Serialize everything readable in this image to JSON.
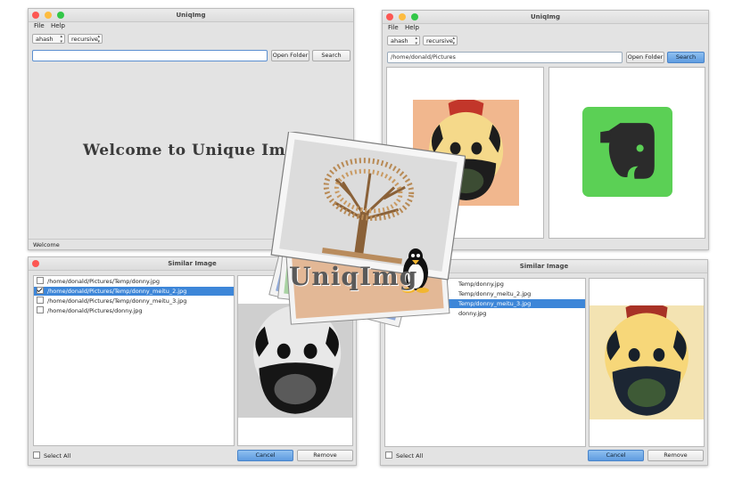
{
  "main_window": {
    "title": "UniqImg",
    "menu": [
      "File",
      "Help"
    ],
    "algorithm": "ahash",
    "mode": "recursive",
    "path_value": "",
    "open_folder": "Open Folder",
    "search": "Search",
    "welcome": "Welcome to Unique Image",
    "status": "Welcome"
  },
  "results_window": {
    "title": "UniqImg",
    "menu": [
      "File",
      "Help"
    ],
    "algorithm": "ahash",
    "mode": "recursive",
    "path_value": "/home/donald/Pictures",
    "open_folder": "Open Folder",
    "search": "Search"
  },
  "similar_left": {
    "title": "Similar Image",
    "items": [
      {
        "label": "/home/donald/Pictures/Temp/donny.jpg",
        "checked": false
      },
      {
        "label": "/home/donald/Pictures/Temp/donny_meitu_2.jpg",
        "checked": true
      },
      {
        "label": "/home/donald/Pictures/Temp/donny_meitu_3.jpg",
        "checked": false
      },
      {
        "label": "/home/donald/Pictures/donny.jpg",
        "checked": false
      }
    ],
    "select_all": "Select All",
    "cancel": "Cancel",
    "remove": "Remove"
  },
  "similar_right": {
    "title": "Similar Image",
    "items": [
      {
        "label": "Temp/donny.jpg"
      },
      {
        "label": "Temp/donny_meitu_2.jpg"
      },
      {
        "label": "Temp/donny_meitu_3.jpg"
      },
      {
        "label": "donny.jpg"
      }
    ],
    "select_all": "Select All",
    "cancel": "Cancel",
    "remove": "Remove"
  },
  "logo": {
    "text": "UniqImg",
    "icons": [
      "tree-icon",
      "penguin-icon"
    ]
  },
  "colors": {
    "selection": "#3d86d8",
    "button_blue": "#5e9be0",
    "evernote_green": "#5bd055"
  },
  "icons": [
    "donny-face-icon",
    "evernote-elephant-icon",
    "checkbox-icon"
  ]
}
